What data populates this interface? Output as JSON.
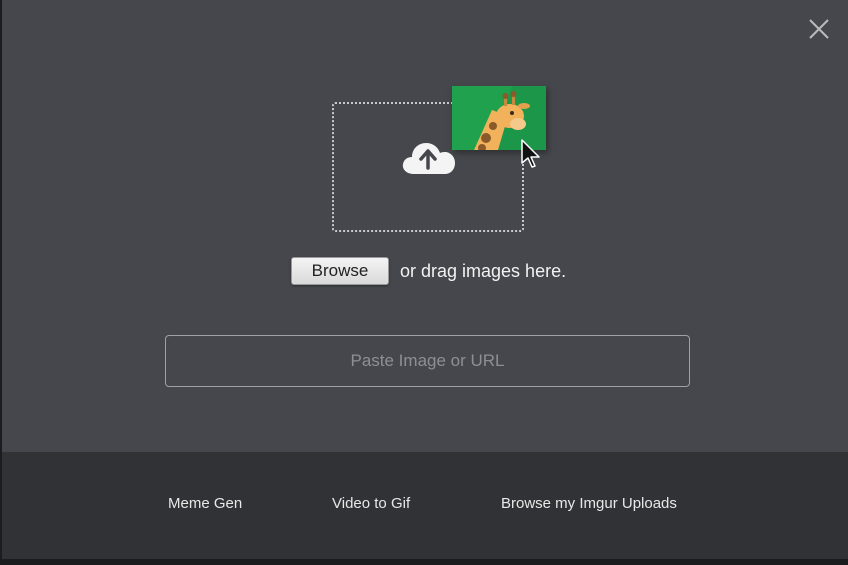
{
  "upload": {
    "browse_label": "Browse",
    "drag_text": "or drag images here.",
    "url_placeholder": "Paste Image or URL"
  },
  "footer": {
    "links": [
      {
        "label": "Meme Gen"
      },
      {
        "label": "Video to Gif"
      },
      {
        "label": "Browse my Imgur Uploads"
      }
    ]
  },
  "colors": {
    "modal_bg": "#45474c",
    "footer_bg": "#313235",
    "card_green": "#1fa14e"
  },
  "icons": [
    "close-icon",
    "cloud-upload-icon",
    "giraffe-image-icon",
    "mouse-cursor-icon"
  ]
}
